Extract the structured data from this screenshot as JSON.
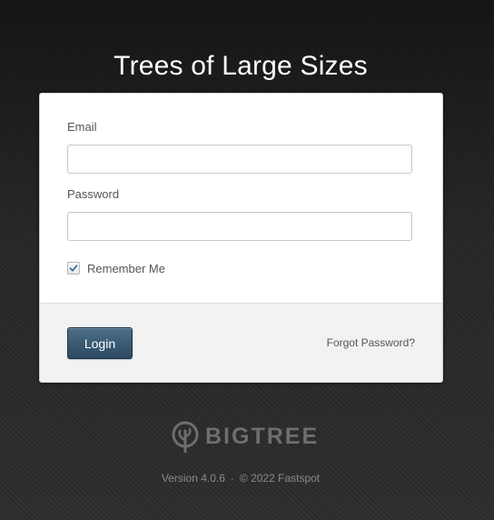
{
  "app": {
    "title": "Trees of Large Sizes"
  },
  "form": {
    "email_label": "Email",
    "email_value": "",
    "password_label": "Password",
    "password_value": "",
    "remember_label": "Remember Me",
    "remember_checked": true,
    "login_label": "Login",
    "forgot_label": "Forgot Password?"
  },
  "footer": {
    "brand": "BIGTREE",
    "brand_icon": "tree-icon",
    "version": "Version 4.0.6",
    "separator": "·",
    "copyright": "© 2022 Fastspot"
  },
  "colors": {
    "button": "#2f4d66",
    "checkmark": "#3d6f99"
  }
}
